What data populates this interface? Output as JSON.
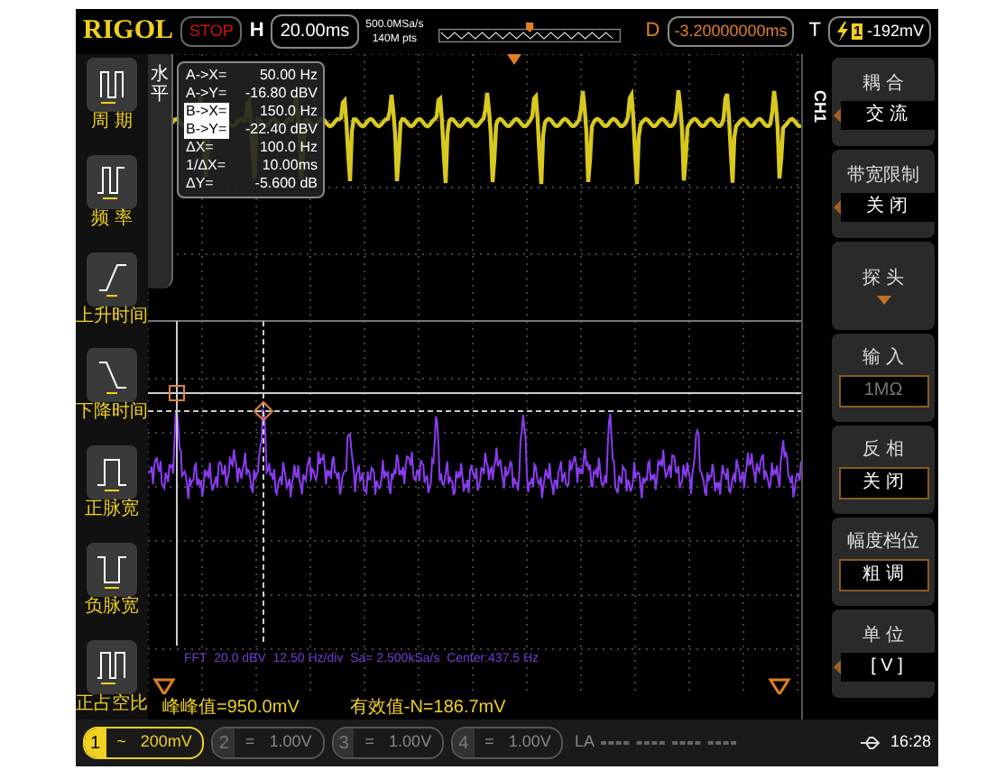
{
  "top_bar": {
    "logo": "RIGOL",
    "run_state": "STOP",
    "horizontal_label": "H",
    "timebase": "20.00ms",
    "sample_rate": "500.0MSa/s",
    "memory_depth": "140M pts",
    "delay_label": "D",
    "delay": "-3.20000000ms",
    "trigger_label": "T",
    "trigger_source": "1",
    "trigger_level": "-192mV"
  },
  "measure_menu": [
    {
      "label": "周 期",
      "kind": "period"
    },
    {
      "label": "频 率",
      "kind": "frequency"
    },
    {
      "label": "上升时间",
      "kind": "rise"
    },
    {
      "label": "下降时间",
      "kind": "fall"
    },
    {
      "label": "正脉宽",
      "kind": "pos_width"
    },
    {
      "label": "负脉宽",
      "kind": "neg_width"
    },
    {
      "label": "正占空比",
      "kind": "pos_duty"
    }
  ],
  "side_tab": "水平",
  "cursor_readout": [
    {
      "label": "A->X=",
      "value": "50.00 Hz",
      "selected": false
    },
    {
      "label": "A->Y=",
      "value": "-16.80 dBV",
      "selected": false
    },
    {
      "label": "B->X=",
      "value": "150.0 Hz",
      "selected": true
    },
    {
      "label": "B->Y=",
      "value": "-22.40 dBV",
      "selected": true
    },
    {
      "label": "ΔX=",
      "value": "100.0 Hz",
      "selected": false
    },
    {
      "label": "1/ΔX=",
      "value": "10.00ms",
      "selected": false
    },
    {
      "label": "ΔY=",
      "value": "-5.600 dB",
      "selected": false
    }
  ],
  "fft_label": "FFT  20.0 dBV  12.50 Hz/div  Sa= 2.500kSa/s  Center:437.5 Hz",
  "measurements": [
    "峰峰值=950.0mV",
    "有效值-N=186.7mV"
  ],
  "channel_menu": {
    "title": "CH1",
    "items": [
      {
        "label": "耦 合",
        "kind": "cycle",
        "value": "交 流",
        "disabled": false
      },
      {
        "label": "带宽限制",
        "kind": "cycle",
        "value": "关 闭",
        "disabled": false
      },
      {
        "label": "探 头",
        "kind": "submenu"
      },
      {
        "label": "输 入",
        "kind": "boxed",
        "value": "1MΩ",
        "disabled": true
      },
      {
        "label": "反 相",
        "kind": "boxed",
        "value": "关 闭",
        "disabled": false
      },
      {
        "label": "幅度档位",
        "kind": "boxed",
        "value": "粗 调",
        "disabled": false
      },
      {
        "label": "单 位",
        "kind": "cycle",
        "value": "[ V ]",
        "disabled": false
      }
    ]
  },
  "channels": [
    {
      "number": "1",
      "coupling": "~",
      "scale": "200mV",
      "selected": true
    },
    {
      "number": "2",
      "coupling": "=",
      "scale": "1.00V",
      "selected": false
    },
    {
      "number": "3",
      "coupling": "=",
      "scale": "1.00V",
      "selected": false
    },
    {
      "number": "4",
      "coupling": "=",
      "scale": "1.00V",
      "selected": false
    }
  ],
  "la_label": "LA",
  "clock": "16:28"
}
